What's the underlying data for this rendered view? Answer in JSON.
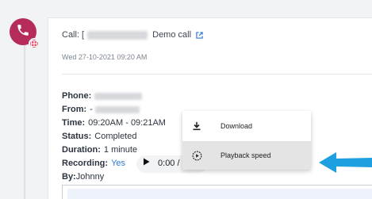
{
  "call": {
    "title_prefix": "Call: [",
    "title_suffix": "Demo call",
    "date": "Wed 27-10-2021 09:20 AM"
  },
  "details": {
    "phone_label": "Phone:",
    "from_label": "From:",
    "from_prefix": "-",
    "time_label": "Time:",
    "time_value": "09:20AM - 09:21AM",
    "status_label": "Status:",
    "status_value": "Completed",
    "duration_label": "Duration:",
    "duration_value": "1 minute",
    "recording_label": "Recording:",
    "recording_value": "Yes",
    "by_label": "By:",
    "by_value": "Johnny"
  },
  "player": {
    "time": "0:00 /"
  },
  "menu": {
    "download": "Download",
    "playback_speed": "Playback speed"
  },
  "colors": {
    "avatar": "#b52b59",
    "badge": "#e8536c",
    "link": "#2f7ad3",
    "arrow": "#1ea0e0"
  }
}
